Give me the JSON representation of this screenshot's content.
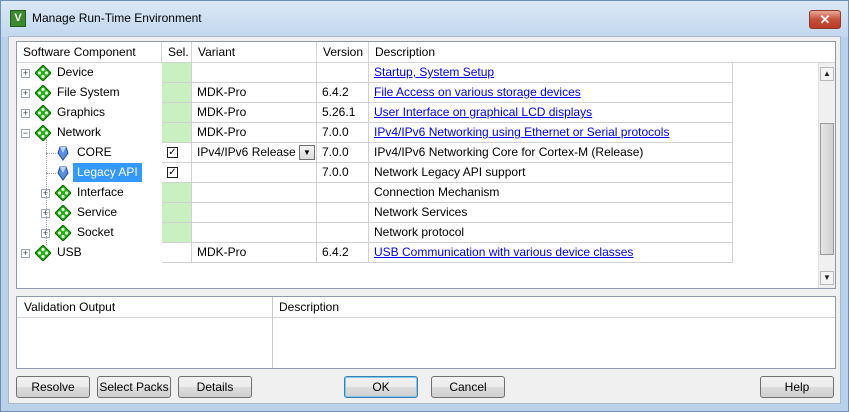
{
  "window": {
    "title": "Manage Run-Time Environment",
    "app_icon_glyph": "V",
    "close_glyph": "✕"
  },
  "grid": {
    "columns": [
      "Software Component",
      "Sel.",
      "Variant",
      "Version",
      "Description"
    ],
    "rows": [
      {
        "component": "Device",
        "level": 0,
        "expand": "+",
        "icon": "green-diamond-icon",
        "sel": "",
        "variant": "",
        "version": "",
        "description": "Startup, System Setup",
        "link": true,
        "green": true
      },
      {
        "component": "File System",
        "level": 0,
        "expand": "+",
        "icon": "green-diamond-icon",
        "sel": "",
        "variant": "MDK-Pro",
        "version": "6.4.2",
        "description": "File Access on various storage devices",
        "link": true,
        "green": true
      },
      {
        "component": "Graphics",
        "level": 0,
        "expand": "+",
        "icon": "green-diamond-icon",
        "sel": "",
        "variant": "MDK-Pro",
        "version": "5.26.1",
        "description": "User Interface on graphical LCD displays",
        "link": true,
        "green": true
      },
      {
        "component": "Network",
        "level": 0,
        "expand": "−",
        "icon": "green-diamond-icon",
        "sel": "",
        "variant": "MDK-Pro",
        "version": "7.0.0",
        "description": "IPv4/IPv6 Networking using Ethernet or Serial protocols",
        "link": true,
        "green": true
      },
      {
        "component": "CORE",
        "level": 1,
        "expand": "",
        "icon": "blue-gem-icon",
        "sel": "✓",
        "variant": "IPv4/IPv6 Release",
        "dropdown": true,
        "version": "7.0.0",
        "description": "IPv4/IPv6 Networking Core for Cortex-M (Release)",
        "link": false,
        "green": false
      },
      {
        "component": "Legacy API",
        "level": 1,
        "expand": "",
        "icon": "blue-gem-icon",
        "sel": "✓",
        "variant": "",
        "version": "7.0.0",
        "description": "Network Legacy API support",
        "link": false,
        "green": false,
        "selected": true
      },
      {
        "component": "Interface",
        "level": 1,
        "expand": "+",
        "icon": "green-diamond-icon",
        "sel": "",
        "variant": "",
        "version": "",
        "description": "Connection Mechanism",
        "link": false,
        "green": true
      },
      {
        "component": "Service",
        "level": 1,
        "expand": "+",
        "icon": "green-diamond-icon",
        "sel": "",
        "variant": "",
        "version": "",
        "description": "Network Services",
        "link": false,
        "green": true
      },
      {
        "component": "Socket",
        "level": 1,
        "expand": "+",
        "icon": "green-diamond-icon",
        "sel": "",
        "variant": "",
        "version": "",
        "description": "Network protocol",
        "link": false,
        "green": true
      },
      {
        "component": "USB",
        "level": 0,
        "expand": "+",
        "icon": "green-diamond-icon",
        "sel": "",
        "variant": "MDK-Pro",
        "version": "6.4.2",
        "description": "USB Communication with various device classes",
        "link": true,
        "green": false
      }
    ]
  },
  "validation": {
    "col_output": "Validation Output",
    "col_description": "Description"
  },
  "buttons": {
    "resolve": "Resolve",
    "select_packs": "Select Packs",
    "details": "Details",
    "ok": "OK",
    "cancel": "Cancel",
    "help": "Help"
  },
  "colors": {
    "selected_green": "#c8f0c0",
    "highlight_blue": "#3399ff",
    "link_blue": "#0000ee"
  }
}
